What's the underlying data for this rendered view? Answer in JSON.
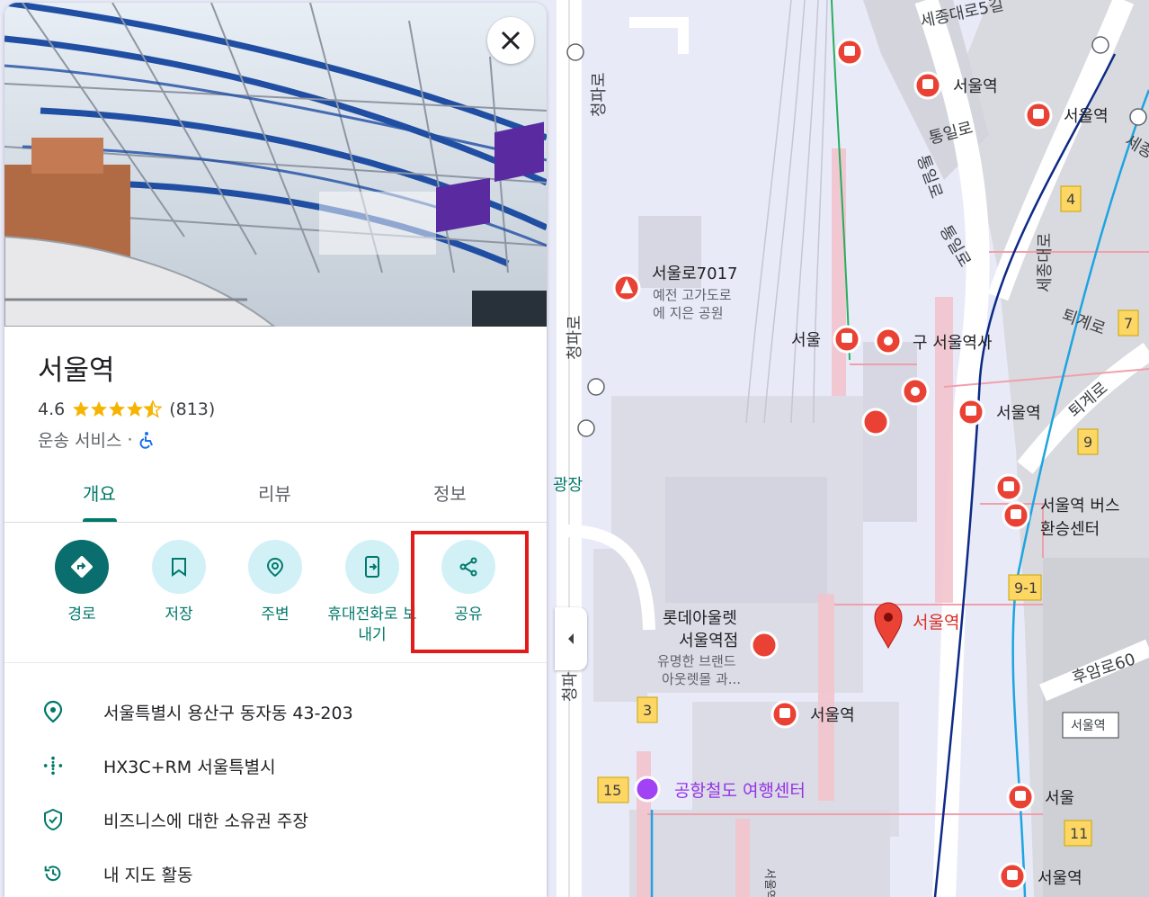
{
  "place": {
    "name": "서울역",
    "rating": "4.6",
    "review_count": "(813)",
    "category": "운송 서비스",
    "separator": "·"
  },
  "tabs": [
    {
      "label": "개요",
      "active": true
    },
    {
      "label": "리뷰",
      "active": false
    },
    {
      "label": "정보",
      "active": false
    }
  ],
  "actions": {
    "directions": "경로",
    "save": "저장",
    "nearby": "주변",
    "send_to_phone_line1": "휴대전화로 보",
    "send_to_phone_line2": "내기",
    "share": "공유"
  },
  "details": {
    "address": "서울특별시 용산구 동자동 43-203",
    "plus_code": "HX3C+RM 서울특별시",
    "claim": "비즈니스에 대한 소유권 주장",
    "my_maps": "내 지도 활동"
  },
  "map_labels": {
    "sejongdaero5gil": "세종대로5길",
    "seoulyeok_top": "서울역",
    "seoulyeok_top2": "서울역",
    "tongil_ro": "통일로",
    "tongil_ro_v1": "통일로",
    "tongil_ro_v2": "통일로",
    "sejong_daero": "세종대로",
    "sejong_short": "세종",
    "cheongpa_ro_top": "청파로",
    "cheongpa_ro_mid": "청파로",
    "cheongpa_ro_bot": "청파",
    "seoullo_title": "서울로7017",
    "seoullo_desc1": "예전 고가도로",
    "seoullo_desc2": "에 지은 공원",
    "seoul_station_label": "서울",
    "old_station": "구 서울역사",
    "seoulyeok_right": "서울역",
    "toegye_ro1": "퇴계로",
    "toegye_ro2": "퇴계로",
    "bus_center1": "서울역 버스",
    "bus_center2": "환승센터",
    "plaza_fragment": "광장",
    "lotte1": "롯데아울렛",
    "lotte2": "서울역점",
    "lotte3": "유명한 브랜드",
    "lotte4": "아웃렛몰 과...",
    "main_pin": "서울역",
    "seoulyeok_bottom": "서울역",
    "arex_center": "공항철도 여행센터",
    "huam_ro": "후암로60",
    "seoulyeok_box": "서울역",
    "seoul_bottom": "서울",
    "seoulyeok_br": "서울역",
    "vertical_seoul": "서울역",
    "exit_4": "4",
    "exit_7": "7",
    "exit_9": "9",
    "exit_9_1": "9-1",
    "exit_3": "3",
    "exit_15": "15",
    "exit_11": "11"
  },
  "colors": {
    "accent": "#00796b",
    "action_bg": "#d2f1f7",
    "star": "#f4b400",
    "transit_red": "#e94235",
    "highlight": "#e21b1b",
    "map_bg": "#e8e9f7"
  }
}
